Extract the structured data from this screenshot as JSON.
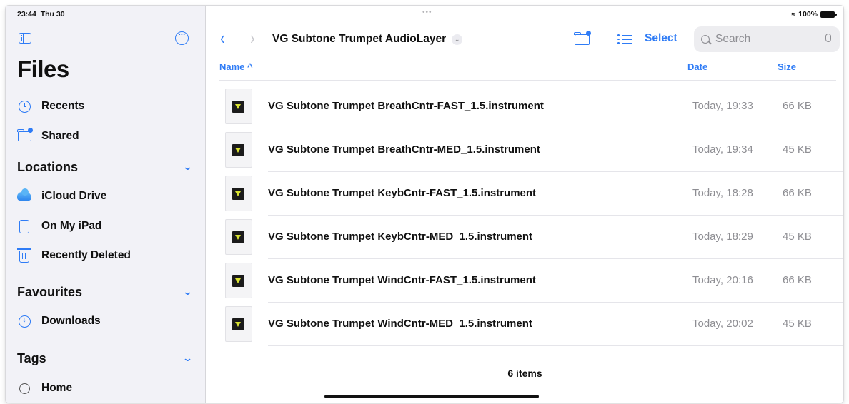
{
  "status_bar": {
    "time": "23:44",
    "date": "Thu 30",
    "dots": "•••",
    "battery": "100%"
  },
  "sidebar": {
    "title": "Files",
    "top_items": [
      {
        "label": "Recents",
        "icon": "clock-icon"
      },
      {
        "label": "Shared",
        "icon": "shared-folder-icon"
      }
    ],
    "locations": {
      "title": "Locations",
      "items": [
        {
          "label": "iCloud Drive",
          "icon": "icloud-icon"
        },
        {
          "label": "On My iPad",
          "icon": "ipad-icon"
        },
        {
          "label": "Recently Deleted",
          "icon": "trash-icon"
        }
      ]
    },
    "favourites": {
      "title": "Favourites",
      "items": [
        {
          "label": "Downloads",
          "icon": "download-icon"
        }
      ]
    },
    "tags": {
      "title": "Tags",
      "items": [
        {
          "label": "Home",
          "icon": "tag-circle-icon"
        }
      ]
    }
  },
  "toolbar": {
    "back_icon": "‹",
    "forward_icon": "›",
    "folder_title": "VG Subtone Trumpet AudioLayer",
    "select_label": "Select",
    "search_placeholder": "Search"
  },
  "columns": {
    "name": "Name ^",
    "date": "Date",
    "size": "Size"
  },
  "files": [
    {
      "name": "VG Subtone Trumpet BreathCntr-FAST_1.5.instrument",
      "date": "Today, 19:33",
      "size": "66 KB"
    },
    {
      "name": "VG Subtone Trumpet BreathCntr-MED_1.5.instrument",
      "date": "Today, 19:34",
      "size": "45 KB"
    },
    {
      "name": "VG Subtone Trumpet KeybCntr-FAST_1.5.instrument",
      "date": "Today, 18:28",
      "size": "66 KB"
    },
    {
      "name": "VG Subtone Trumpet KeybCntr-MED_1.5.instrument",
      "date": "Today, 18:29",
      "size": "45 KB"
    },
    {
      "name": "VG Subtone Trumpet WindCntr-FAST_1.5.instrument",
      "date": "Today, 20:16",
      "size": "66 KB"
    },
    {
      "name": "VG Subtone Trumpet WindCntr-MED_1.5.instrument",
      "date": "Today, 20:02",
      "size": "45 KB"
    }
  ],
  "footer": {
    "items_count": "6 items"
  },
  "colors": {
    "accent": "#2f7cf6",
    "sidebar_bg": "#f2f2f7",
    "secondary_text": "#8e8e93"
  }
}
